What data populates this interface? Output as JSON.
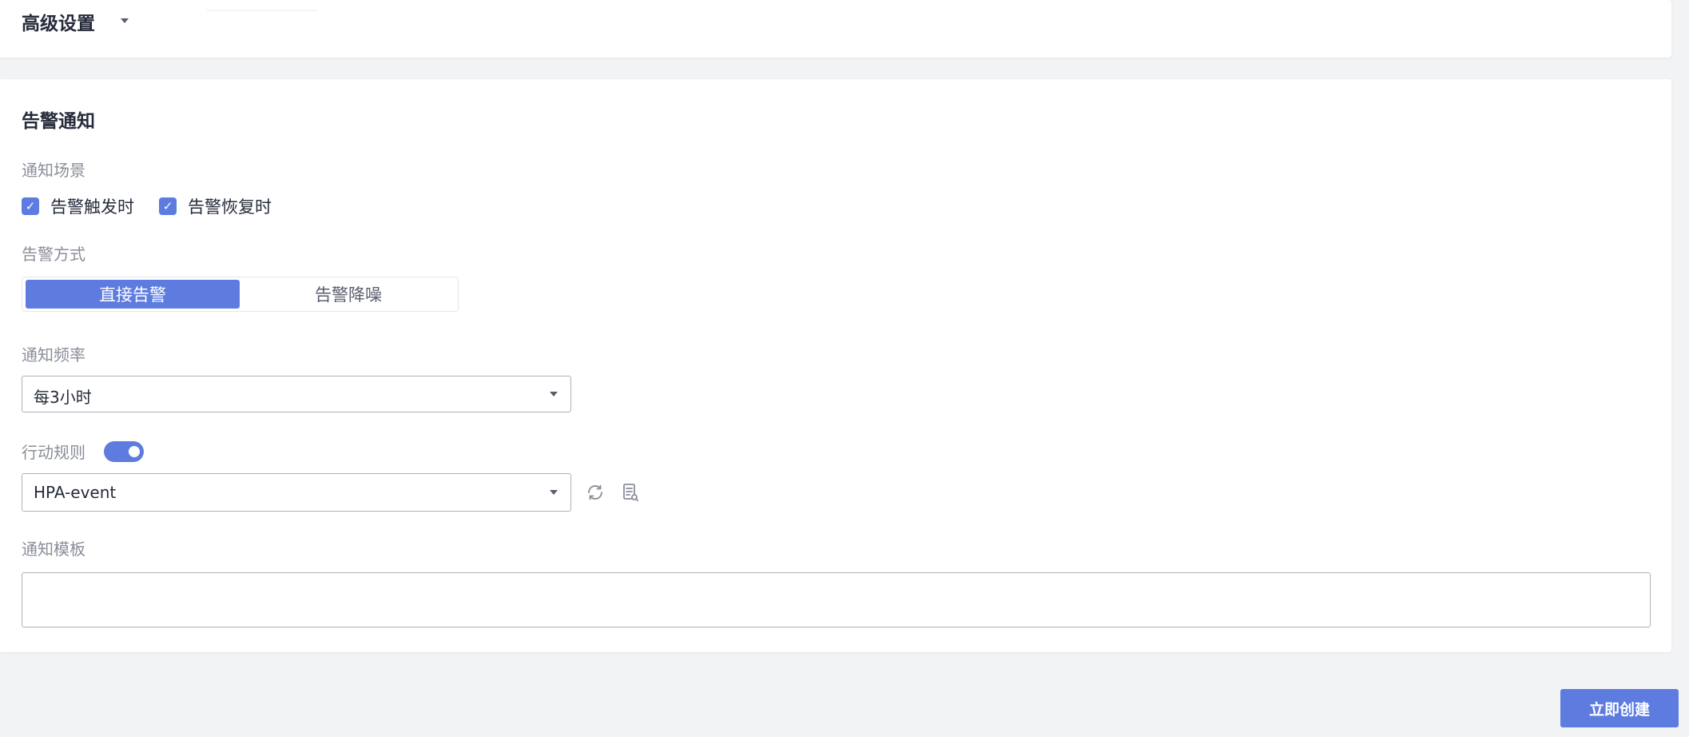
{
  "advanced": {
    "title": "高级设置"
  },
  "notification": {
    "title": "告警通知",
    "scene": {
      "label": "通知场景",
      "options": [
        {
          "label": "告警触发时",
          "checked": true
        },
        {
          "label": "告警恢复时",
          "checked": true
        }
      ]
    },
    "mode": {
      "label": "告警方式",
      "options": [
        "直接告警",
        "告警降噪"
      ],
      "selected": "直接告警"
    },
    "frequency": {
      "label": "通知频率",
      "value": "每3小时"
    },
    "action_rule": {
      "label": "行动规则",
      "enabled": true,
      "value": "HPA-event",
      "refresh_icon": "refresh-icon",
      "view_icon": "document-view-icon"
    },
    "template": {
      "label": "通知模板",
      "value": ""
    }
  },
  "footer": {
    "create_label": "立即创建"
  },
  "colors": {
    "primary": "#5e7ce0",
    "text": "#252b3a",
    "label": "#8a8e99",
    "border": "#adb0b8"
  }
}
